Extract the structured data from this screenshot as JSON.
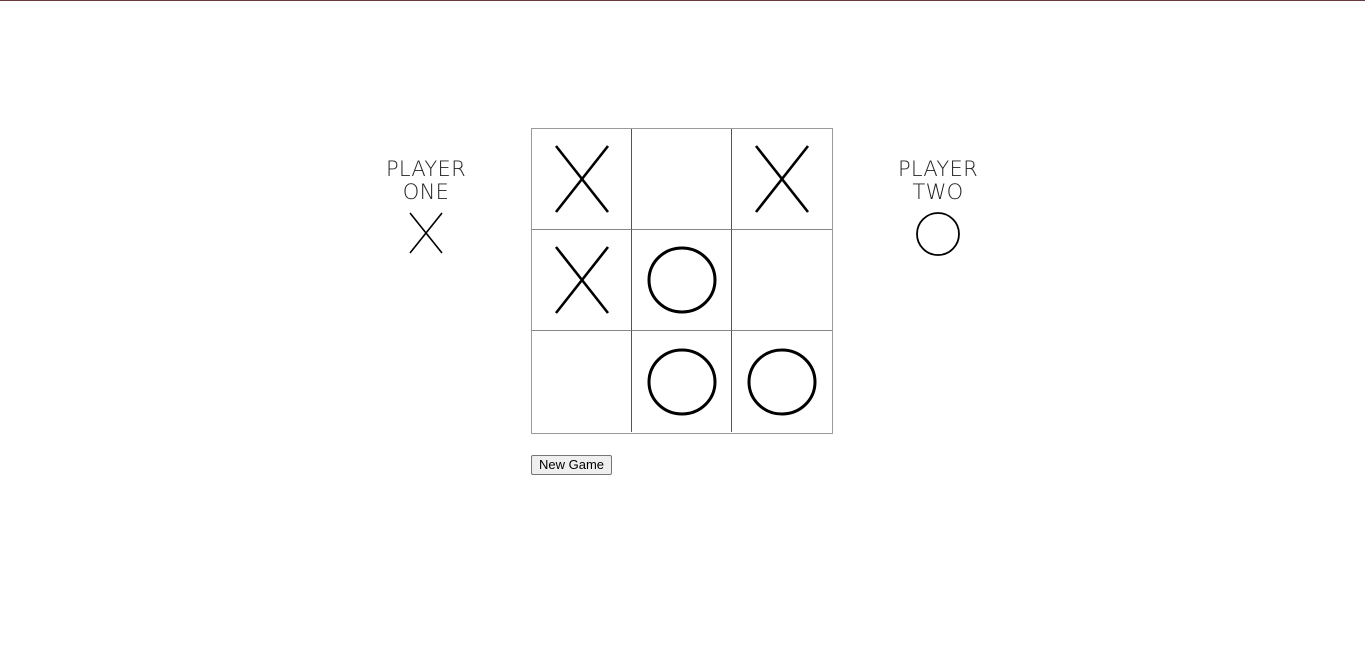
{
  "players": {
    "one": {
      "line1": "PLAYER",
      "line2": "ONE",
      "mark": "X",
      "icon": "x-mark-icon"
    },
    "two": {
      "line1": "PLAYER",
      "line2": "TWO",
      "mark": "O",
      "icon": "o-mark-icon"
    }
  },
  "board": {
    "cells": [
      "X",
      "",
      "X",
      "X",
      "O",
      "",
      "",
      "O",
      "O"
    ]
  },
  "controls": {
    "new_game_label": "New Game"
  },
  "colors": {
    "mark": "#000000",
    "top_rule": "#6b3a3a"
  }
}
